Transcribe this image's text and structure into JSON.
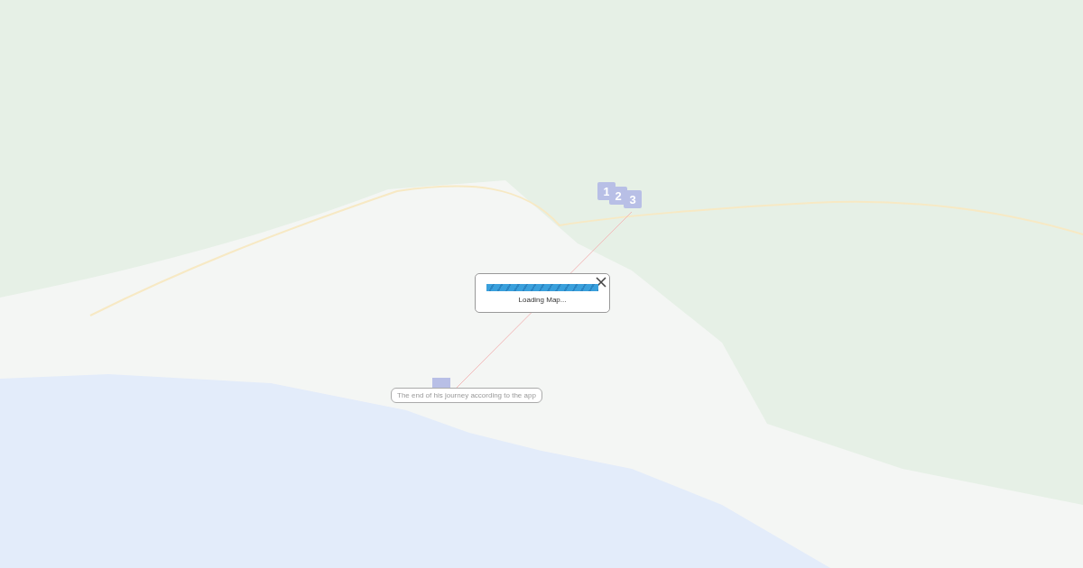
{
  "map": {
    "markers": [
      {
        "label": "1"
      },
      {
        "label": "2"
      },
      {
        "label": "3"
      }
    ],
    "tooltip": "The end of his journey according to the app",
    "loading_dialog": {
      "message": "Loading Map...",
      "progress": {
        "level": 1
      }
    }
  }
}
